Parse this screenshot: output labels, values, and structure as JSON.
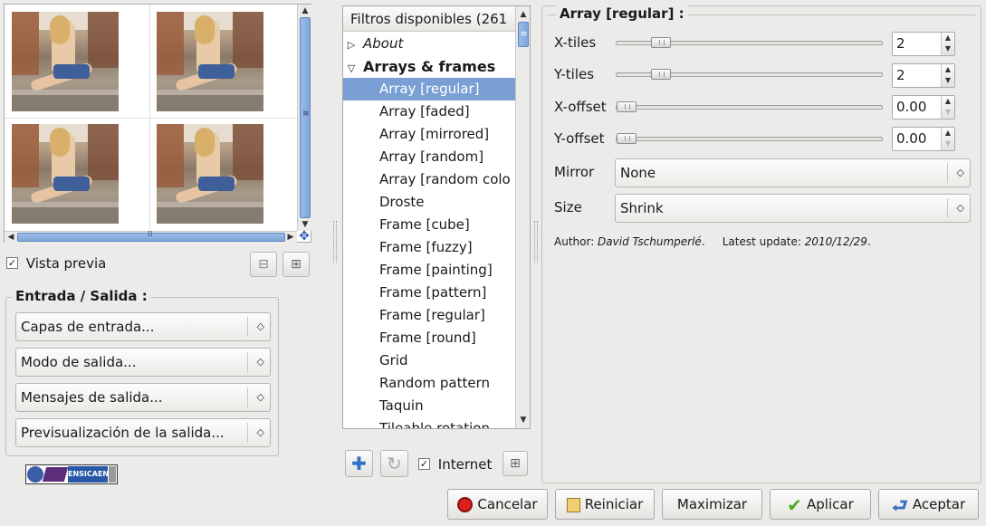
{
  "preview": {
    "checkbox_label": "Vista previa",
    "checkbox_mark": "✓",
    "zoom_out": "⊟",
    "zoom_in": "⊞"
  },
  "io": {
    "title": "Entrada / Salida :",
    "input_layers": "Capas de entrada...",
    "output_mode": "Modo de salida...",
    "output_messages": "Mensajes de salida...",
    "output_preview": "Previsualización de la salida..."
  },
  "logo": {
    "text": "ENSICAEN"
  },
  "filters": {
    "header": "Filtros disponibles (261",
    "items": [
      {
        "label": "About",
        "italic": true,
        "expander": "▷"
      },
      {
        "label": "Arrays & frames",
        "bold": true,
        "expander": "▽"
      },
      {
        "label": "Array [regular]",
        "selected": true
      },
      {
        "label": "Array [faded]"
      },
      {
        "label": "Array [mirrored]"
      },
      {
        "label": "Array [random]"
      },
      {
        "label": "Array [random colo"
      },
      {
        "label": "Droste"
      },
      {
        "label": "Frame [cube]"
      },
      {
        "label": "Frame [fuzzy]"
      },
      {
        "label": "Frame [painting]"
      },
      {
        "label": "Frame [pattern]"
      },
      {
        "label": "Frame [regular]"
      },
      {
        "label": "Frame [round]"
      },
      {
        "label": "Grid"
      },
      {
        "label": "Random pattern"
      },
      {
        "label": "Taquin"
      },
      {
        "label": "Tileable rotation"
      }
    ],
    "internet_label": "Internet",
    "internet_mark": "✓"
  },
  "params": {
    "title": "Array [regular] :",
    "xtiles_label": "X-tiles",
    "xtiles_value": "2",
    "xtiles_level": 0.14,
    "ytiles_label": "Y-tiles",
    "ytiles_value": "2",
    "ytiles_level": 0.14,
    "xoffset_label": "X-offset",
    "xoffset_value": "0.00",
    "xoffset_level": 0,
    "yoffset_label": "Y-offset",
    "yoffset_value": "0.00",
    "yoffset_level": 0,
    "mirror_label": "Mirror",
    "mirror_value": "None",
    "size_label": "Size",
    "size_value": "Shrink",
    "author_prefix": "Author: ",
    "author_name": "David Tschumperlé",
    "update_prefix": ".     Latest update: ",
    "update_date": "2010/12/29",
    "update_suffix": "."
  },
  "actions": {
    "cancel": "Cancelar",
    "reset": "Reiniciar",
    "maximize": "Maximizar",
    "apply": "Aplicar",
    "accept": "Aceptar"
  },
  "colors": {
    "selection": "#7a9fd4",
    "scroll_thumb": "#8fb2e0",
    "cancel_red": "#d9201c",
    "apply_green": "#4caa2a",
    "accept_blue": "#3a6fc4"
  }
}
